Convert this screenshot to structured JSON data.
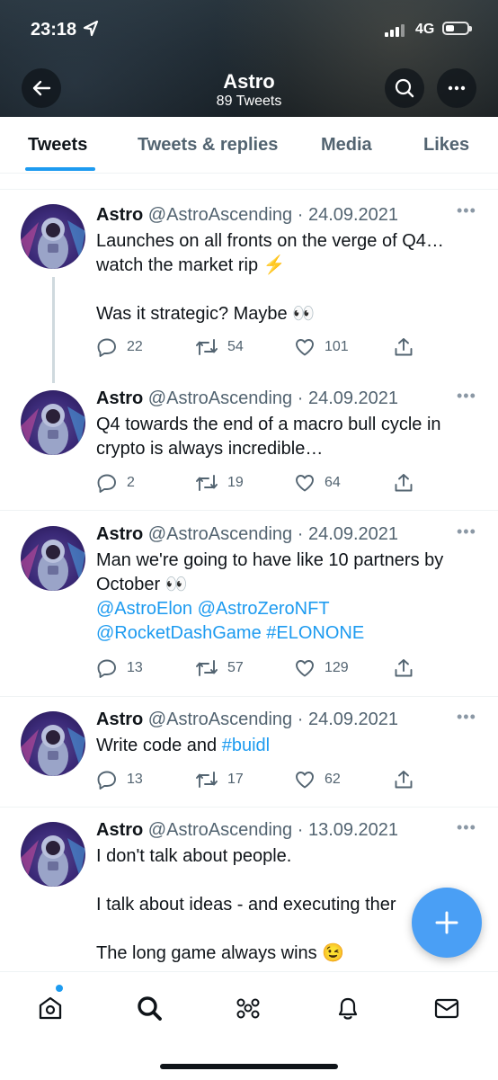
{
  "status_bar": {
    "time": "23:18",
    "network": "4G",
    "battery_level": 0.35
  },
  "header": {
    "title": "Astro",
    "subtitle": "89 Tweets",
    "back_icon": "arrow-left-icon",
    "search_icon": "search-icon",
    "more_icon": "more-horizontal-icon"
  },
  "tabs": [
    {
      "label": "Tweets",
      "active": true
    },
    {
      "label": "Tweets & replies",
      "active": false
    },
    {
      "label": "Media",
      "active": false
    },
    {
      "label": "Likes",
      "active": false
    }
  ],
  "tweets": [
    {
      "name": "Astro",
      "meta": "@AstroAscending · 24.09.2021",
      "lines": [
        "Launches on all fronts on the verge of Q4…",
        "watch the market rip ⚡",
        "",
        "Was it strategic? Maybe 👀"
      ],
      "replies": "22",
      "retweets": "54",
      "likes": "101"
    },
    {
      "name": "Astro",
      "meta": "@AstroAscending · 24.09.2021",
      "lines": [
        "Q4 towards the end of a macro bull cycle in",
        "crypto is always incredible…"
      ],
      "replies": "2",
      "retweets": "19",
      "likes": "64"
    },
    {
      "name": "Astro",
      "meta": "@AstroAscending · 24.09.2021",
      "lines": [
        "Man we're going to have like 10 partners by",
        "October 👀"
      ],
      "mentions_line1": "@AstroElon @AstroZeroNFT",
      "mentions_line2": "@RocketDashGame #ELONONE",
      "replies": "13",
      "retweets": "57",
      "likes": "129"
    },
    {
      "name": "Astro",
      "meta": "@AstroAscending · 24.09.2021",
      "text_prefix": "Write code and ",
      "hashtag": "#buidl",
      "replies": "13",
      "retweets": "17",
      "likes": "62"
    },
    {
      "name": "Astro",
      "meta": "@AstroAscending · 13.09.2021",
      "lines": [
        "I don't talk about people.",
        "",
        "I talk about ideas - and executing ther",
        "",
        "The long game always wins 😉"
      ]
    }
  ],
  "fab": {
    "icon": "compose-plus-icon"
  },
  "bottom_nav": [
    {
      "icon": "home-icon",
      "has_notification_dot": true
    },
    {
      "icon": "search-icon"
    },
    {
      "icon": "spaces-icon"
    },
    {
      "icon": "bell-icon"
    },
    {
      "icon": "mail-icon"
    }
  ],
  "colors": {
    "accent": "#1d9bf0",
    "text": "#0f1419",
    "secondary": "#536471"
  }
}
